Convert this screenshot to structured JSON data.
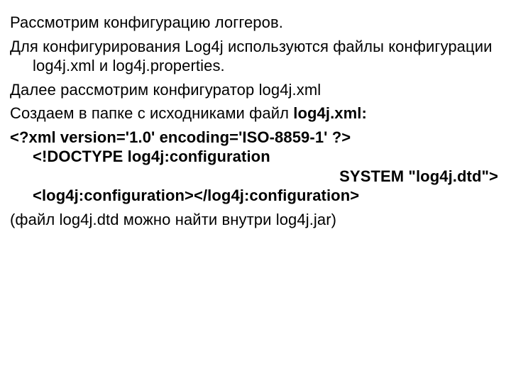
{
  "p1": "Рассмотрим конфигурацию логгеров.",
  "p2": "Для конфигурирования Log4j используются файлы конфигурации log4j.xml и log4j.properties.",
  "p3": "Далее рассмотрим конфигуратор log4j.xml",
  "p4_a": "Создаем в папке с исходниками файл ",
  "p4_b": "log4j.xml:",
  "code_line1_a": "<?xml version='1.0' encoding='ISO-8859-1' ?> ",
  "code_line1_b": "<!DOCTYPE log4j:configuration",
  "code_line2": "SYSTEM \"log4j.dtd\"> ",
  "code_line2_tail": "<log4j:configuration></log4j:configuration>",
  "p5": "(файл log4j.dtd можно найти внутри log4j.jar)"
}
